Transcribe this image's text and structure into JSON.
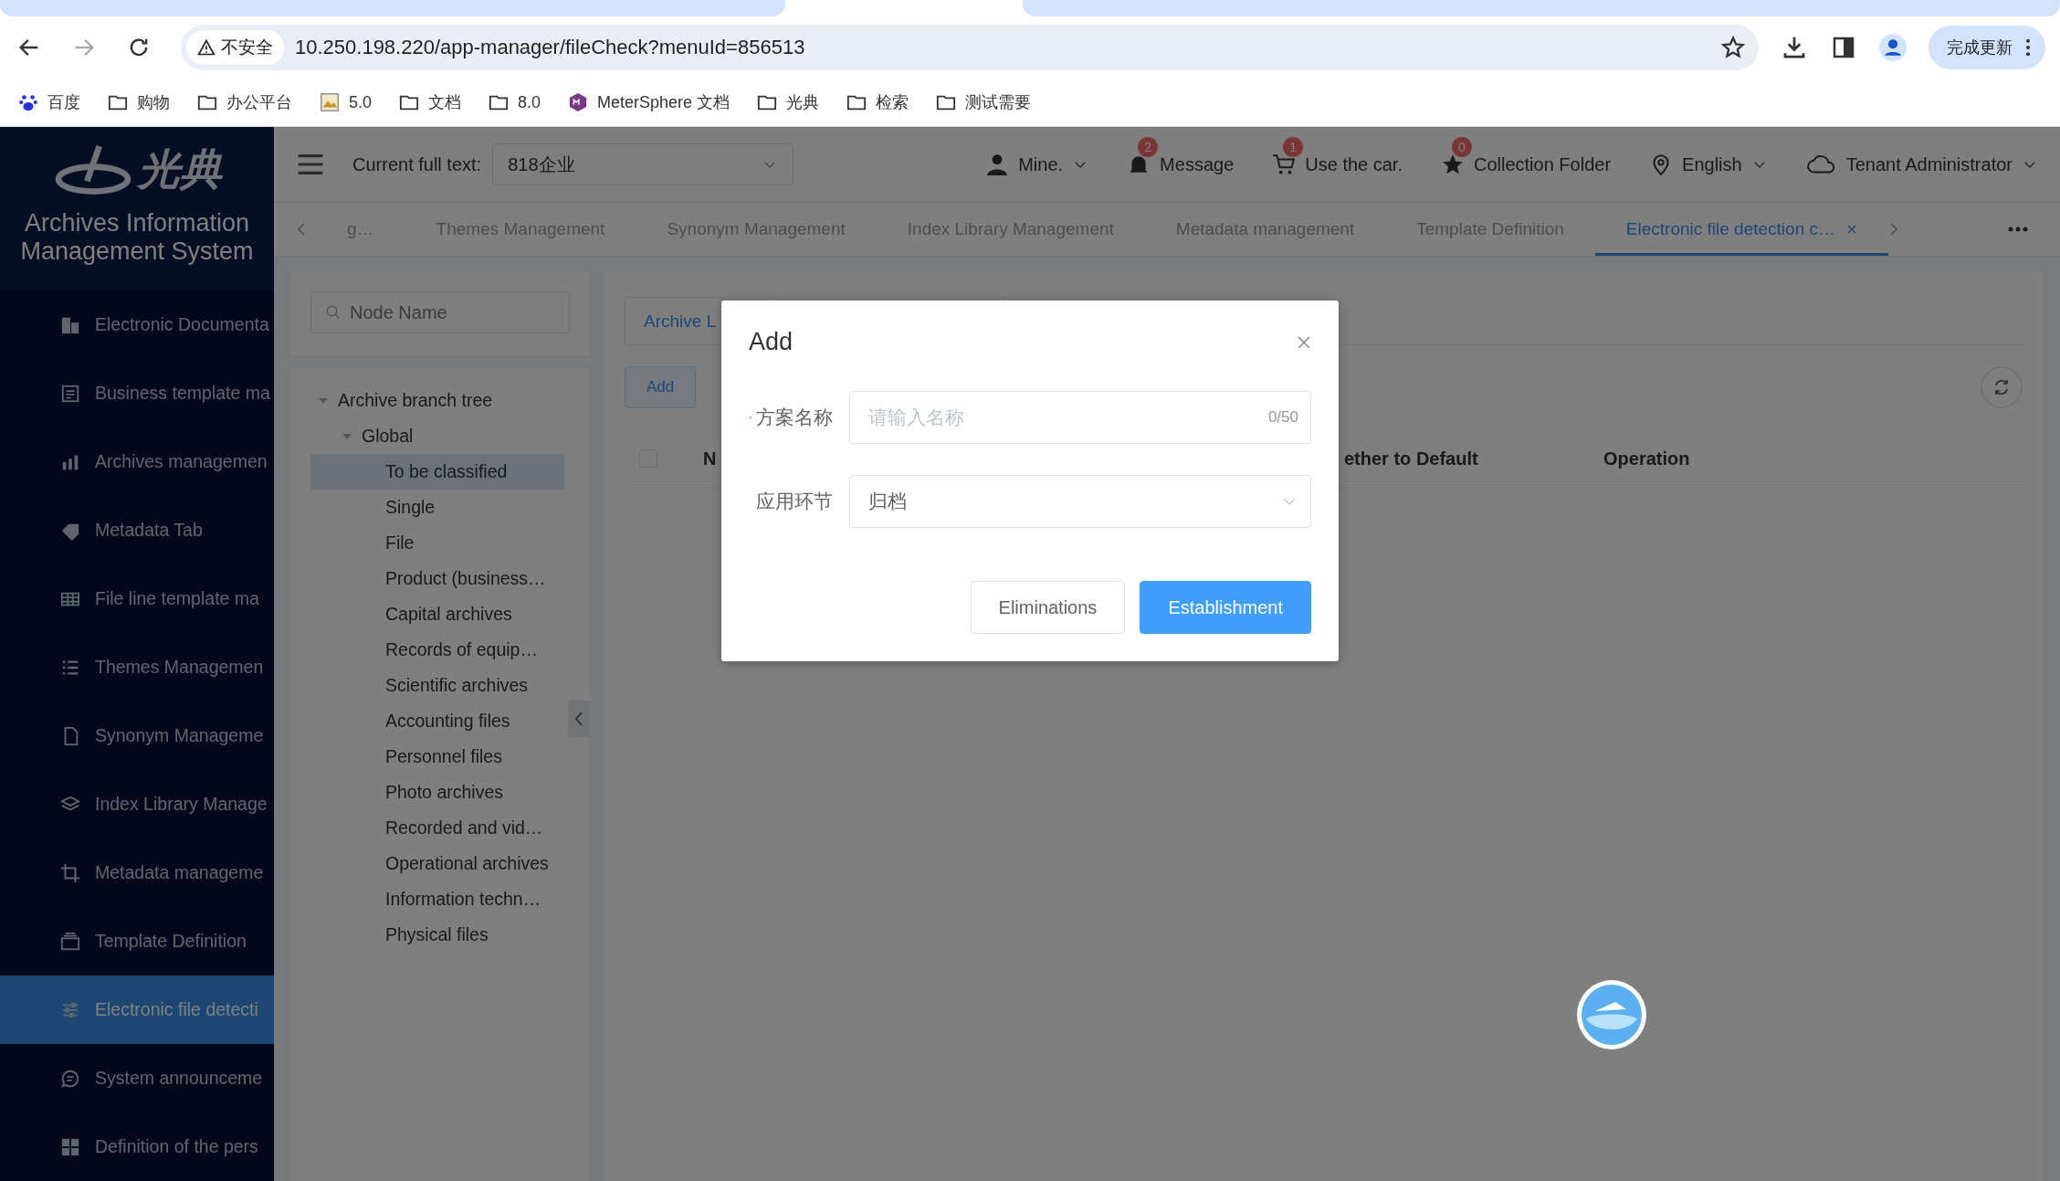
{
  "browser": {
    "security": "不安全",
    "url": "10.250.198.220/app-manager/fileCheck?menuId=856513",
    "update_button": "完成更新",
    "bookmarks": [
      {
        "kind": "baidu",
        "label": "百度"
      },
      {
        "kind": "folder",
        "label": "购物"
      },
      {
        "kind": "folder",
        "label": "办公平台"
      },
      {
        "kind": "image",
        "label": "5.0"
      },
      {
        "kind": "folder",
        "label": "文档"
      },
      {
        "kind": "folder",
        "label": "8.0"
      },
      {
        "kind": "ms",
        "label": "MeterSphere 文档"
      },
      {
        "kind": "folder",
        "label": "光典"
      },
      {
        "kind": "folder",
        "label": "检索"
      },
      {
        "kind": "folder",
        "label": "测试需要"
      }
    ]
  },
  "sidebar": {
    "logo_text": "光典",
    "title": "Archives Information Management System",
    "items": [
      {
        "label": "Electronic Documenta",
        "selected": false
      },
      {
        "label": "Business template ma",
        "selected": false
      },
      {
        "label": "Archives managemen",
        "selected": false
      },
      {
        "label": "Metadata Tab",
        "selected": false
      },
      {
        "label": "File line template ma",
        "selected": false
      },
      {
        "label": "Themes Managemen",
        "selected": false
      },
      {
        "label": "Synonym Manageme",
        "selected": false
      },
      {
        "label": "Index Library Manage",
        "selected": false
      },
      {
        "label": "Metadata manageme",
        "selected": false
      },
      {
        "label": "Template Definition",
        "selected": false
      },
      {
        "label": "Electronic file detecti",
        "selected": true
      },
      {
        "label": "System announceme",
        "selected": false
      },
      {
        "label": "Definition of the pers",
        "selected": false
      }
    ]
  },
  "header": {
    "current_label": "Current full text:",
    "current_value": "818企业",
    "user": "Mine.",
    "message": {
      "label": "Message",
      "count": "2"
    },
    "car": {
      "label": "Use the car.",
      "count": "1"
    },
    "collection": {
      "label": "Collection Folder",
      "count": "0"
    },
    "language": "English",
    "role": "Tenant Administrator"
  },
  "tabs": [
    {
      "label": "g…",
      "selected": false,
      "closable": false
    },
    {
      "label": "Themes Management",
      "selected": false,
      "closable": false
    },
    {
      "label": "Synonym Management",
      "selected": false,
      "closable": false
    },
    {
      "label": "Index Library Management",
      "selected": false,
      "closable": false
    },
    {
      "label": "Metadata management",
      "selected": false,
      "closable": false
    },
    {
      "label": "Template Definition",
      "selected": false,
      "closable": false
    },
    {
      "label": "Electronic file detection c…",
      "selected": true,
      "closable": true
    }
  ],
  "tree": {
    "search_placeholder": "Node Name",
    "nodes": [
      {
        "label": "Archive branch tree",
        "selected": false,
        "expanded": true,
        "children": [
          {
            "label": "Global",
            "selected": false,
            "expanded": true,
            "children": [
              {
                "label": "To be classified",
                "selected": true
              },
              {
                "label": "Single",
                "selected": false
              },
              {
                "label": "File",
                "selected": false
              },
              {
                "label": "Product (business…",
                "selected": false
              },
              {
                "label": "Capital archives",
                "selected": false
              },
              {
                "label": "Records of equip…",
                "selected": false
              },
              {
                "label": "Scientific archives",
                "selected": false
              },
              {
                "label": "Accounting files",
                "selected": false
              },
              {
                "label": "Personnel files",
                "selected": false
              },
              {
                "label": "Photo archives",
                "selected": false
              },
              {
                "label": "Recorded and vid…",
                "selected": false
              },
              {
                "label": "Operational archives",
                "selected": false
              },
              {
                "label": "Information techn…",
                "selected": false
              },
              {
                "label": "Physical files",
                "selected": false
              }
            ]
          }
        ]
      }
    ]
  },
  "content": {
    "tabs": [
      {
        "label": "Archive L",
        "selected": true
      }
    ],
    "add_button": "Add",
    "select_all": {
      "checked": false
    },
    "columns": [
      "N",
      "ether to Default",
      "Operation"
    ]
  },
  "dialog": {
    "title": "Add",
    "fields": [
      {
        "kind": "input",
        "label": "方案名称",
        "required": true,
        "placeholder": "请输入名称",
        "counter": "0/50"
      },
      {
        "kind": "select",
        "label": "应用环节",
        "required": false,
        "value": "归档"
      }
    ],
    "buttons": [
      {
        "label": "Eliminations",
        "primary": false
      },
      {
        "label": "Establishment",
        "primary": true
      }
    ]
  }
}
